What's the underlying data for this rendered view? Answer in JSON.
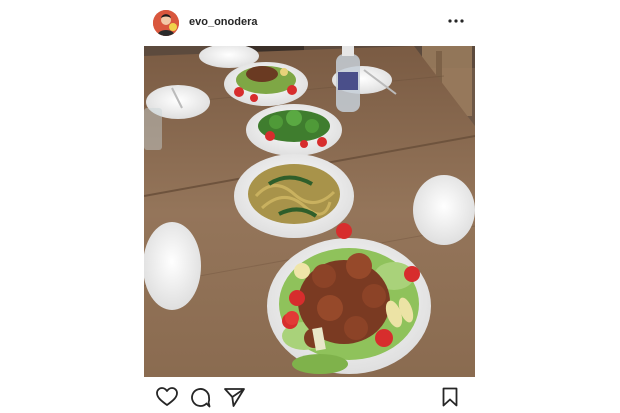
{
  "post": {
    "username": "evo_onodera",
    "icons": {
      "avatar": "profile-photo",
      "more": "more-options-icon",
      "like": "heart-icon",
      "comment": "comment-icon",
      "share": "send-icon",
      "save": "bookmark-icon"
    }
  },
  "colors": {
    "text": "#262626",
    "background": "#ffffff",
    "table": "#8a6a4f"
  }
}
